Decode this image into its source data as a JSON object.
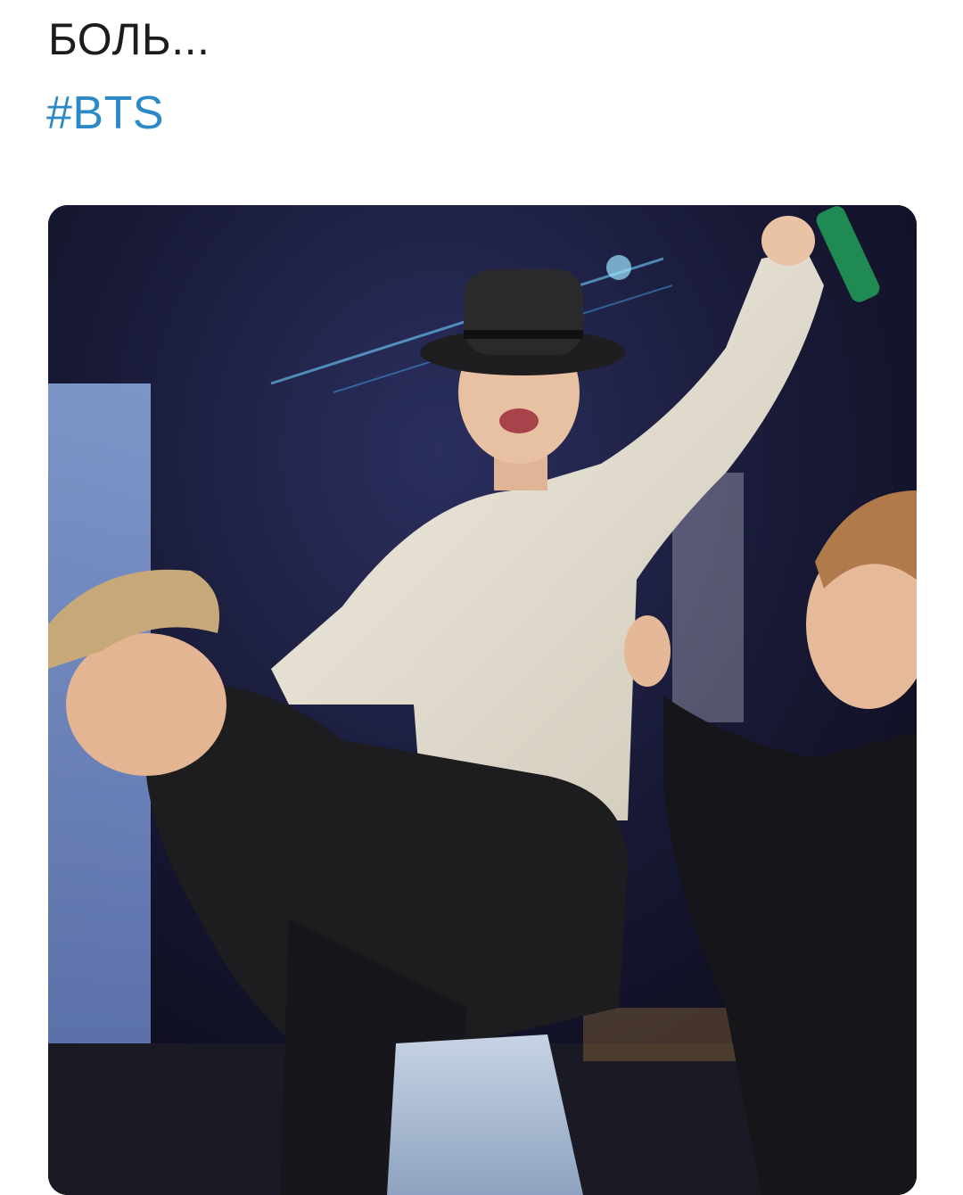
{
  "tweet": {
    "text": "БОЛЬ...",
    "hashtag": "#BTS"
  },
  "media": {
    "type": "photo"
  },
  "colors": {
    "text": "#1c1c1c",
    "hashtag": "#2b8ac6",
    "background": "#ffffff"
  }
}
